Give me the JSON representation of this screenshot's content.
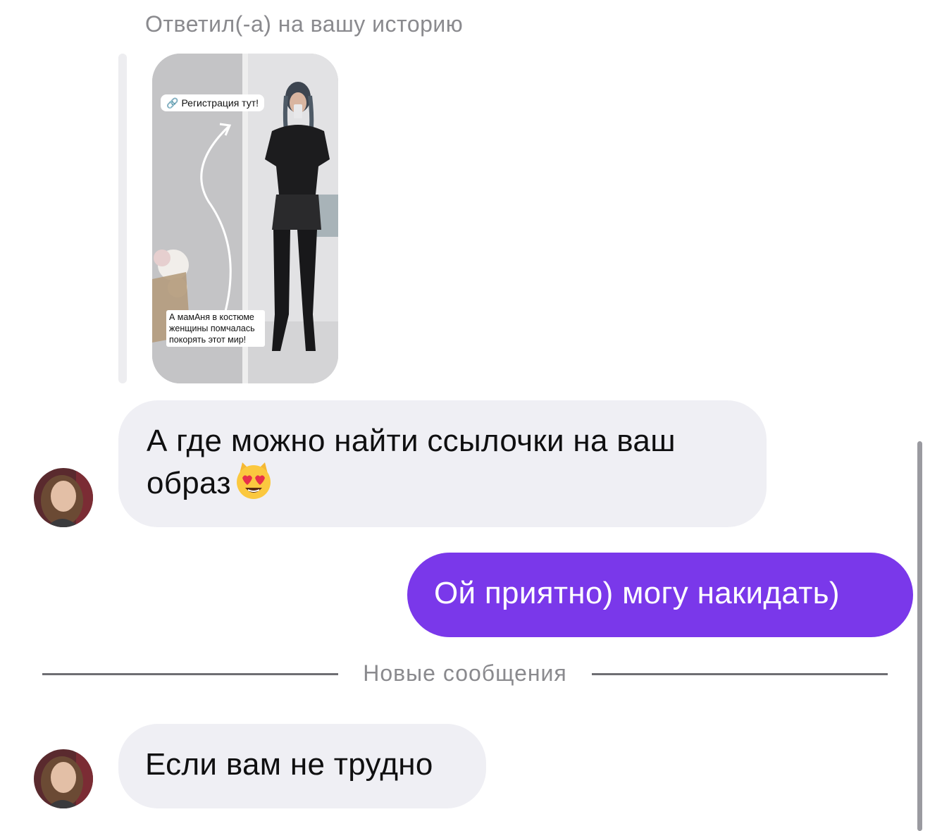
{
  "story_reply": {
    "caption": "Ответил(-а) на вашу историю",
    "link_sticker": "Регистрация тут!",
    "link_icon": "link-icon",
    "text_sticker": "А мамАня в костюме женщины помчалась покорять этот мир!"
  },
  "messages": [
    {
      "direction": "incoming",
      "text": "А где можно найти ссылочки на ваш образ",
      "emoji": "😻"
    },
    {
      "direction": "outgoing",
      "text": "Ой приятно) могу накидать)"
    },
    {
      "direction": "incoming",
      "text": "Если вам не трудно"
    }
  ],
  "new_messages_divider": "Новые сообщения",
  "colors": {
    "outgoing_bubble": "#7a38ea",
    "incoming_bubble": "#efeff4",
    "secondary_text": "#8a8a8e"
  }
}
